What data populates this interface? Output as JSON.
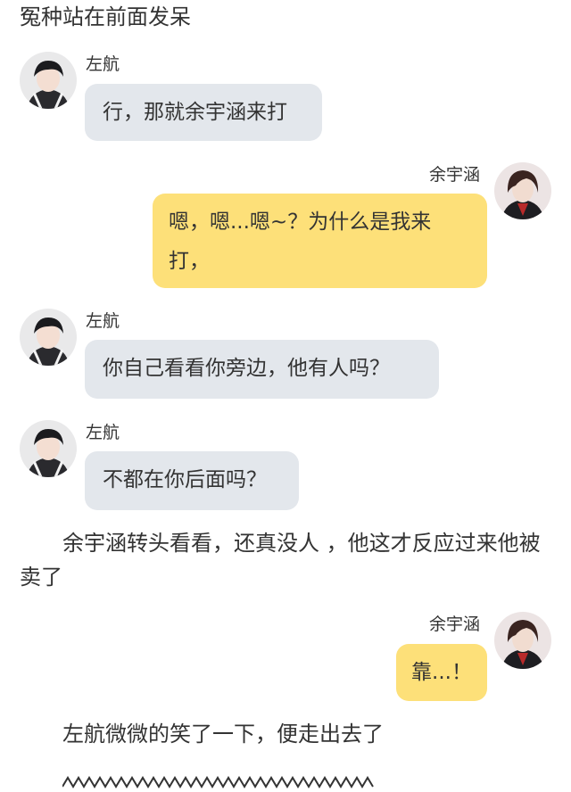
{
  "narration_top": "冤种站在前面发呆",
  "messages": [
    {
      "sender": "左航",
      "side": "left",
      "text": "行，那就余宇涵来打"
    },
    {
      "sender": "余宇涵",
      "side": "right",
      "text": "嗯，嗯...嗯~？为什么是我来打，"
    },
    {
      "sender": "左航",
      "side": "left",
      "text": "你自己看看你旁边，他有人吗？"
    },
    {
      "sender": "左航",
      "side": "left",
      "text": "不都在你后面吗？"
    },
    {
      "sender": "余宇涵",
      "side": "right",
      "text": "靠...！"
    }
  ],
  "narration_middle": "余宇涵转头看看，还真没人 ，他这才反应过来他被卖了",
  "narration_bottom": "左航微微的笑了一下，便走出去了",
  "colors": {
    "left_bubble": "#e3e7ec",
    "right_bubble": "#fde079"
  }
}
